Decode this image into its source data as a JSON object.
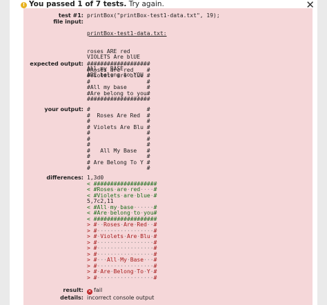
{
  "status": {
    "passed_text": "You passed 1 of 7 tests.",
    "retry_text": "Try again.",
    "warn_glyph": "!",
    "close_glyph": "✕"
  },
  "test": {
    "test_label": "test #1:",
    "test_value": "printBox(\"printBox-test1-data.txt\", 19);",
    "file_label": "file input:",
    "file_name": "printBox-test1-data.txt:",
    "file_lines": [
      "roses ARE red",
      "VIOLETS Are blUE",
      "",
      "All my BASE",
      "ARE belong to YOU"
    ],
    "expected_label": "expected output:",
    "expected_lines": [
      "###################",
      "#Roses are red    #",
      "#Violets are blue #",
      "#                 #",
      "#All my base      #",
      "#Are belong to you#",
      "###################"
    ],
    "your_label": "your output:",
    "your_lines": [
      "#                 #",
      "#  Roses Are Red  #",
      "#                 #",
      "# Violets Are Blu #",
      "#                 #",
      "#                 #",
      "#                 #",
      "#   All My Base   #",
      "#                 #",
      "# Are Belong To Y #",
      "#                 #"
    ],
    "diff_label": "differences:",
    "diff_lines": [
      {
        "t": "hdr",
        "s": "1,3d0"
      },
      {
        "t": "minus",
        "s": "< ###################"
      },
      {
        "t": "minus",
        "s": "< #Roses·are·red····#"
      },
      {
        "t": "minus",
        "s": "< #Violets·are·blue·#"
      },
      {
        "t": "hdr",
        "s": "5,7c2,11"
      },
      {
        "t": "minus",
        "s": "< #All·my·base······#"
      },
      {
        "t": "minus",
        "s": "< #Are·belong·to·you#"
      },
      {
        "t": "minus",
        "s": "< ###################"
      },
      {
        "t": "plus",
        "s": "> #··Roses·Are·Red··#"
      },
      {
        "t": "plus",
        "s": "> #·················#"
      },
      {
        "t": "plus",
        "s": "> #·Violets·Are·Blu·#"
      },
      {
        "t": "plus",
        "s": "> #·················#"
      },
      {
        "t": "plus",
        "s": "> #·················#"
      },
      {
        "t": "plus",
        "s": "> #·················#"
      },
      {
        "t": "plus",
        "s": "> #···All·My·Base···#"
      },
      {
        "t": "plus",
        "s": "> #·················#"
      },
      {
        "t": "plus",
        "s": "> #·Are·Belong·To·Y·#"
      },
      {
        "t": "plus",
        "s": "> #·················#"
      }
    ],
    "result_label": "result:",
    "result_glyph": "✕",
    "result_value": "fail",
    "details_label": "details:",
    "details_value": "incorrect console output"
  },
  "colors": {
    "panel_bg": "#f5d7d9",
    "minus_line": "#1c6e1c",
    "plus_line": "#a51b1b",
    "fail_icon": "#c0282b",
    "warn_icon": "#e8b21f"
  }
}
